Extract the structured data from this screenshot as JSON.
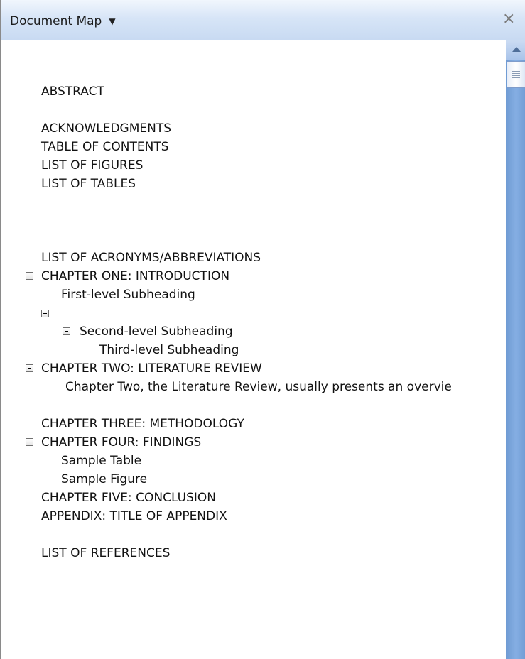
{
  "pane": {
    "title": "Document Map",
    "close_symbol": "×"
  },
  "icons": {
    "dropdown": "chevron-down-icon",
    "close": "close-icon",
    "collapse": "minus-box-icon"
  },
  "tree": {
    "abstract": "ABSTRACT",
    "acknowledgments": "ACKNOWLEDGMENTS",
    "toc": "TABLE OF CONTENTS",
    "figures": "LIST OF FIGURES",
    "tables": "LIST OF TABLES",
    "acronyms": "LIST OF ACRONYMS/ABBREVIATIONS",
    "ch1": "CHAPTER ONE: INTRODUCTION",
    "ch1_sub1": "First-level Subheading",
    "ch1_sub2": "Second-level Subheading",
    "ch1_sub3": "Third-level Subheading",
    "ch2": "CHAPTER TWO: LITERATURE REVIEW",
    "ch2_sub": "Chapter Two, the Literature Review, usually presents an overvie",
    "ch3": "CHAPTER THREE: METHODOLOGY",
    "ch4": "CHAPTER FOUR: FINDINGS",
    "ch4_table": "Sample Table",
    "ch4_figure": "Sample Figure",
    "ch5": "CHAPTER FIVE: CONCLUSION",
    "appendix": "APPENDIX: TITLE OF APPENDIX",
    "references": "LIST OF REFERENCES"
  }
}
